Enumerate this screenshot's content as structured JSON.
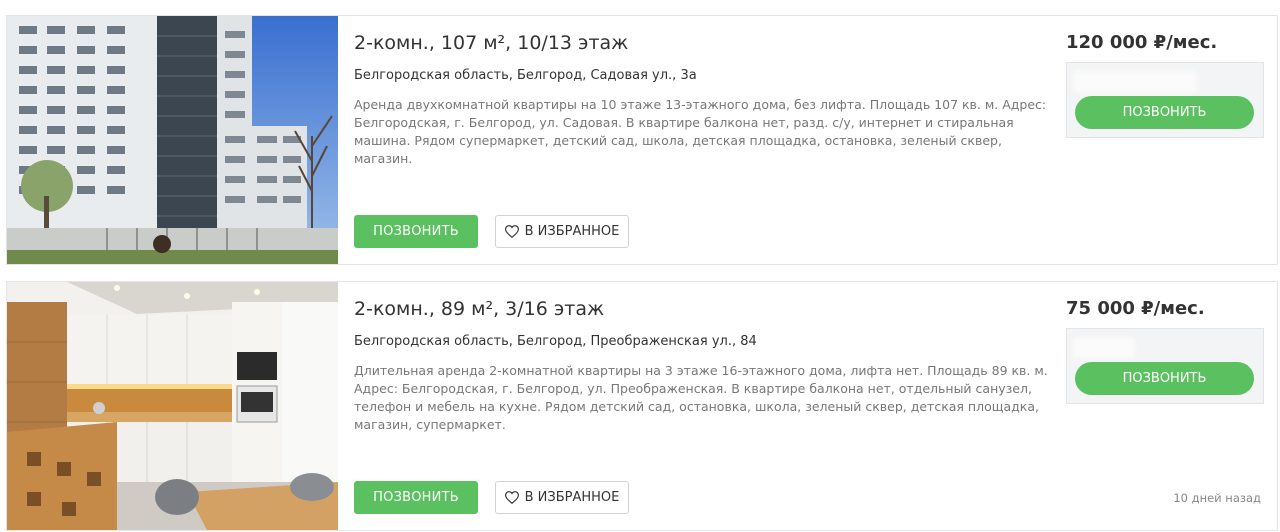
{
  "listings": [
    {
      "title": "2-комн., 107 м², 10/13 этаж",
      "address": "Белгородская область, Белгород, Садовая ул., 3а",
      "description": "Аренда двухкомнатной квартиры на 10 этаже 13-этажного дома, без лифта. Площадь 107 кв. м. Адрес: Белгородская, г. Белгород, ул. Садовая. В квартире балкона нет, разд. с/у, интернет и стиральная машина. Рядом супермаркет, детский сад, школа, детская площадка, остановка, зеленый сквер, магазин.",
      "call_label": "ПОЗВОНИТЬ",
      "favorite_label": "В ИЗБРАННОЕ",
      "price": "120 000 ₽/мес.",
      "side_call_label": "ПОЗВОНИТЬ",
      "date": ""
    },
    {
      "title": "2-комн., 89 м², 3/16 этаж",
      "address": "Белгородская область, Белгород, Преображенская ул., 84",
      "description": "Длительная аренда 2-комнатной квартиры на 3 этаже 16-этажного дома, лифта нет. Площадь 89 кв. м. Адрес: Белгородская, г. Белгород, ул. Преображенская. В квартире балкона нет, отдельный санузел, телефон и мебель на кухне. Рядом детский сад, остановка, школа, зеленый сквер, детская площадка, магазин, супермаркет.",
      "call_label": "ПОЗВОНИТЬ",
      "favorite_label": "В ИЗБРАННОЕ",
      "price": "75 000 ₽/мес.",
      "side_call_label": "ПОЗВОНИТЬ",
      "date": "10 дней назад"
    }
  ],
  "colors": {
    "accent_green": "#5bc160",
    "border": "#e3e6e8",
    "muted_text": "#777777"
  },
  "icons": {
    "favorite": "heart-icon"
  }
}
